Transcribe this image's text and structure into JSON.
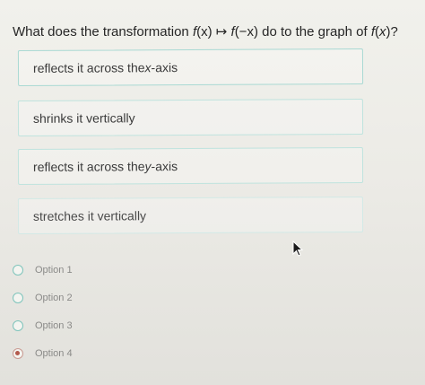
{
  "question": {
    "prefix": "What does the transformation ",
    "fx": "f",
    "arg1": "(x)",
    "arrow": " ↦ ",
    "fneg": "f",
    "arg2": "(−x)",
    "middle": " do to the graph of ",
    "fend": "f",
    "open": "(",
    "xvar": "x",
    "close": ")?"
  },
  "choices": [
    {
      "pre": "reflects it across the ",
      "var": "x",
      "post": "-axis"
    },
    {
      "pre": "shrinks it vertically",
      "var": "",
      "post": ""
    },
    {
      "pre": "reflects it across the ",
      "var": "y",
      "post": "-axis"
    },
    {
      "pre": "stretches it vertically",
      "var": "",
      "post": ""
    }
  ],
  "options": [
    {
      "label": "Option 1",
      "selected": false
    },
    {
      "label": "Option 2",
      "selected": false
    },
    {
      "label": "Option 3",
      "selected": false
    },
    {
      "label": "Option 4",
      "selected": true
    }
  ],
  "colors": {
    "choice_border": "#a9d9d3",
    "radio_border": "#7ec4bb",
    "radio_selected": "#b35a4d"
  }
}
